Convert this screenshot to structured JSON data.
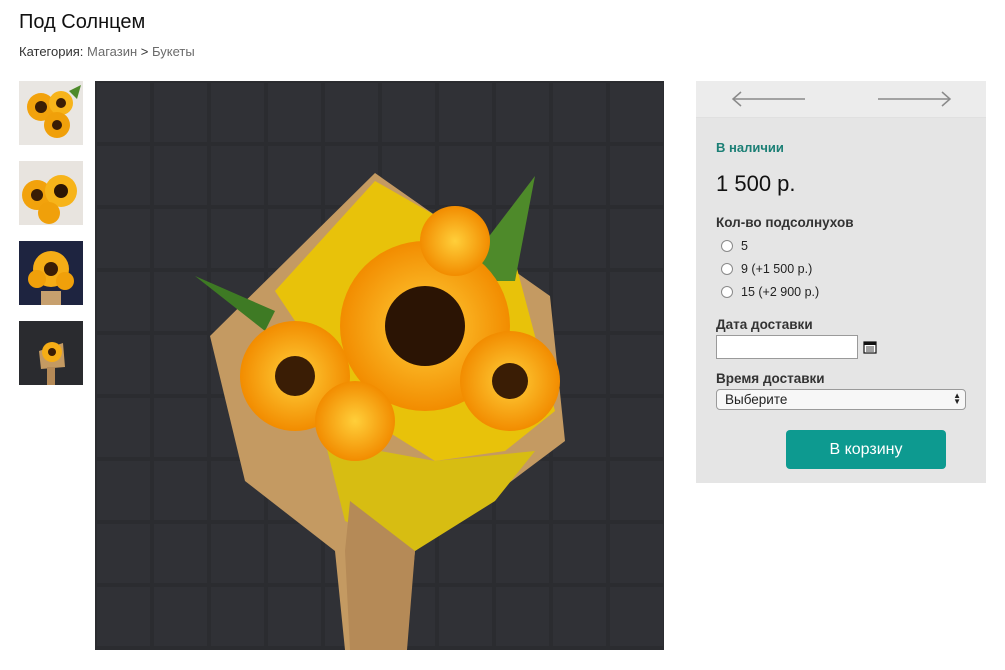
{
  "product": {
    "title": "Под Солнцем"
  },
  "breadcrumb": {
    "prefix": "Категория:",
    "shop": "Магазин",
    "separator": ">",
    "category": "Букеты"
  },
  "gallery": {
    "thumbnails": [
      "sunflower-bouquet-thumb-1",
      "sunflower-bouquet-thumb-2",
      "sunflower-bouquet-thumb-3",
      "sunflower-bouquet-thumb-4"
    ],
    "main_image": "sunflower-bouquet-main"
  },
  "panel": {
    "prev_icon": "arrow-left-icon",
    "next_icon": "arrow-right-icon",
    "stock": "В наличии",
    "price": "1 500 р.",
    "quantity_label": "Кол-во подсолнухов",
    "quantity_options": [
      "5",
      "9 (+1 500 р.)",
      "15 (+2 900 р.)"
    ],
    "date_label": "Дата доставки",
    "date_value": "",
    "time_label": "Время доставки",
    "time_selected": "Выберите",
    "cart_button": "В корзину",
    "accent_color": "#0d9a90",
    "stock_color": "#1b7f75"
  }
}
